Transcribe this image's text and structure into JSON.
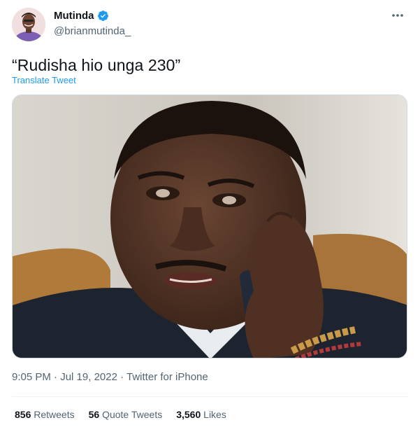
{
  "author": {
    "name": "Mutinda",
    "handle": "@brianmutinda_",
    "verified": true
  },
  "tweet": {
    "text": "“Rudisha hio unga 230”",
    "translate_label": "Translate Tweet",
    "time": "9:05 PM",
    "separator": " · ",
    "date": "Jul 19, 2022",
    "source": "Twitter for iPhone"
  },
  "stats": {
    "retweets": {
      "count": "856",
      "label": "Retweets"
    },
    "quotes": {
      "count": "56",
      "label": "Quote Tweets"
    },
    "likes": {
      "count": "3,560",
      "label": "Likes"
    }
  },
  "icons": {
    "verified": "verified-badge-icon",
    "more": "more-dots-icon"
  },
  "colors": {
    "accent": "#1d9bf0",
    "secondary_text": "#536471",
    "primary_text": "#0f1419"
  }
}
